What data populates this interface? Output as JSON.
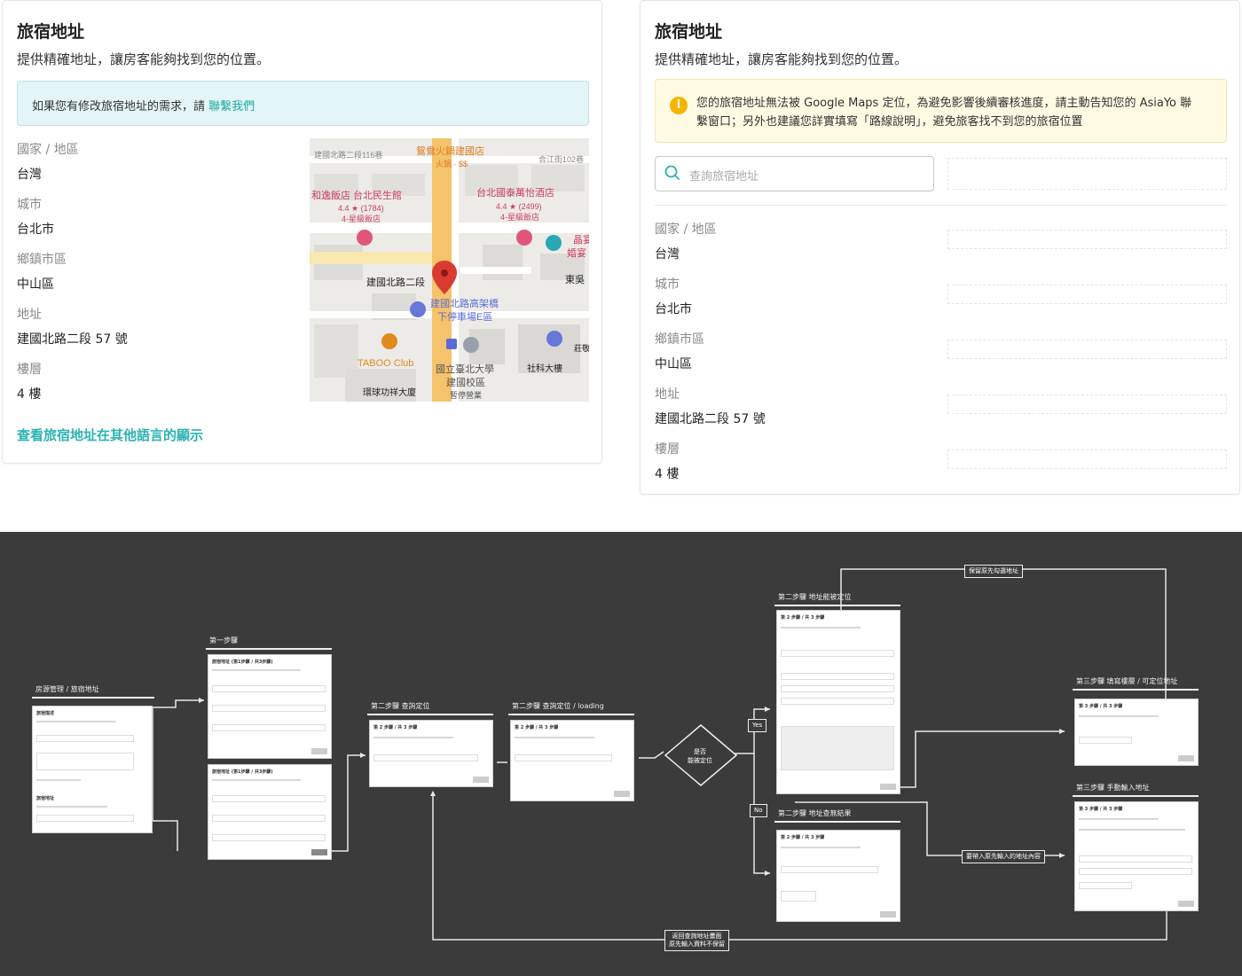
{
  "left_card": {
    "title": "旅宿地址",
    "subtitle": "提供精確地址，讓房客能夠找到您的位置。",
    "info_text": "如果您有修改旅宿地址的需求，請",
    "info_link": "聯繫我們",
    "fields": [
      {
        "label": "國家 / 地區",
        "value": "台灣"
      },
      {
        "label": "城市",
        "value": "台北市"
      },
      {
        "label": "鄉鎮市區",
        "value": "中山區"
      },
      {
        "label": "地址",
        "value": "建國北路二段 57 號"
      },
      {
        "label": "樓層",
        "value": "4 樓"
      }
    ],
    "other_lang_link": "查看旅宿地址在其他語言的顯示",
    "map": {
      "labels": [
        "建國北路二段116巷",
        "鴛鴦火鍋建國店",
        "火鍋 · $$",
        "合江街102巷",
        "和逸飯店 台北民生館",
        "4.4 ★ (1784)",
        "4-星級飯店",
        "台北國泰萬怡酒店",
        "4.4 ★ (2499)",
        "4-星級飯店",
        "晶宴",
        "婚宴",
        "建國北路二段",
        "東吳",
        "建國北路高架橋",
        "下停車場E區",
        "TABOO Club",
        "國立臺北大學",
        "建國校區",
        "暫停營業",
        "莊敬",
        "社科大樓",
        "環球功祥大廈"
      ]
    }
  },
  "right_card": {
    "title": "旅宿地址",
    "subtitle": "提供精確地址，讓房客能夠找到您的位置。",
    "warn_line1": "您的旅宿地址無法被 Google Maps 定位，為避免影響後續審核進度，請主動告知您的 AsiaYo 聯",
    "warn_line2": "繫窗口；另外也建議您詳實填寫「路線說明」，避免旅客找不到您的旅宿位置",
    "search_placeholder": "查詢旅宿地址",
    "fields": [
      {
        "label": "國家 / 地區",
        "value": "台灣"
      },
      {
        "label": "城市",
        "value": "台北市"
      },
      {
        "label": "鄉鎮市區",
        "value": "中山區"
      },
      {
        "label": "地址",
        "value": "建國北路二段 57 號"
      },
      {
        "label": "樓層",
        "value": "4 樓"
      }
    ]
  },
  "flow": {
    "sections": [
      "房源管理 / 旅宿地址",
      "第一步驟",
      "第二步驟 查詢定位",
      "第二步驟 查詢定位 / loading",
      "第二步驟 地址能被定位",
      "第二步驟 地址查無結果",
      "第三步驟 填寫樓層 / 可定位地址",
      "第三步驟 手動輸入地址"
    ],
    "frame_titles": {
      "origin_a": "旅宿描述",
      "origin_b": "旅宿地址",
      "step1": "旅宿地址 (第1步驟 / 共3步驟)",
      "step2": "第 2 步驟 / 共 3 步驟",
      "step3": "第 3 步驟 / 共 3 步驟"
    },
    "diamond_line1": "是否",
    "diamond_line2": "能被定位",
    "yes": "Yes",
    "no": "No",
    "keep_label": "保留原先勾選地址",
    "bring_label": "要帶入原先輸入的地址內容",
    "back_line1": "返回查詢地址畫面",
    "back_line2": "原先輸入資料不保留"
  }
}
